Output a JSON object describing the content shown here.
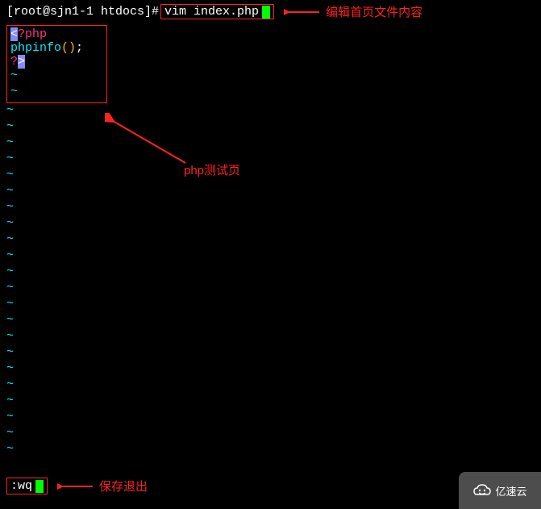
{
  "prompt": {
    "user_host": "[root@sjn1-1 htdocs]# ",
    "command": "vim index.php"
  },
  "annotations": {
    "edit_file": "编辑首页文件内容",
    "test_page": "php测试页",
    "save_exit": "保存退出"
  },
  "code": {
    "open_bracket": "<",
    "open_q": "?",
    "open_word": "php",
    "func_name": "phpinfo",
    "paren_open": "(",
    "paren_close": ")",
    "semi": ";",
    "close_q": "?",
    "close_bracket": ">"
  },
  "bottom": {
    "wq_prefix": ":",
    "wq": "wq"
  },
  "tilde": "~",
  "watermark": {
    "text": "亿速云"
  }
}
